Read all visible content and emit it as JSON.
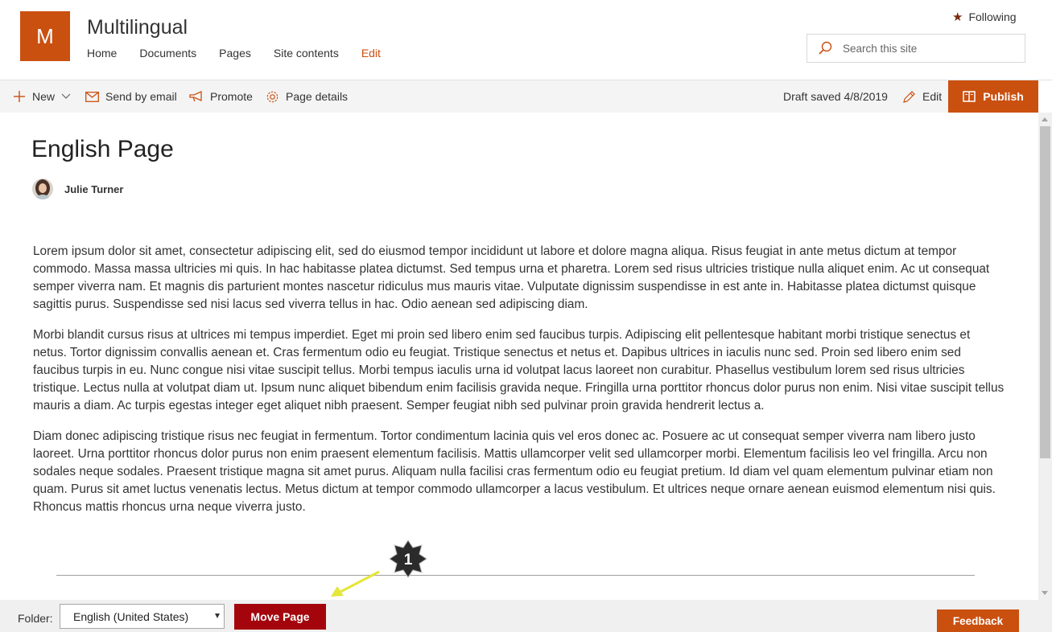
{
  "site": {
    "logo_letter": "M",
    "title": "Multilingual",
    "nav": [
      {
        "label": "Home"
      },
      {
        "label": "Documents"
      },
      {
        "label": "Pages"
      },
      {
        "label": "Site contents"
      },
      {
        "label": "Edit"
      }
    ],
    "following_label": "Following",
    "search_placeholder": "Search this site",
    "accent_color": "#ca5010"
  },
  "command_bar": {
    "new_label": "New",
    "send_email_label": "Send by email",
    "promote_label": "Promote",
    "page_details_label": "Page details",
    "draft_status": "Draft saved 4/8/2019",
    "edit_label": "Edit",
    "publish_label": "Publish"
  },
  "page": {
    "title": "English Page",
    "author": "Julie Turner",
    "paragraphs": [
      "Lorem ipsum dolor sit amet, consectetur adipiscing elit, sed do eiusmod tempor incididunt ut labore et dolore magna aliqua. Risus feugiat in ante metus dictum at tempor commodo. Massa massa ultricies mi quis. In hac habitasse platea dictumst. Sed tempus urna et pharetra. Lorem sed risus ultricies tristique nulla aliquet enim. Ac ut consequat semper viverra nam. Et magnis dis parturient montes nascetur ridiculus mus mauris vitae. Vulputate dignissim suspendisse in est ante in. Habitasse platea dictumst quisque sagittis purus. Suspendisse sed nisi lacus sed viverra tellus in hac. Odio aenean sed adipiscing diam.",
      "Morbi blandit cursus risus at ultrices mi tempus imperdiet. Eget mi proin sed libero enim sed faucibus turpis. Adipiscing elit pellentesque habitant morbi tristique senectus et netus. Tortor dignissim convallis aenean et. Cras fermentum odio eu feugiat. Tristique senectus et netus et. Dapibus ultrices in iaculis nunc sed. Proin sed libero enim sed faucibus turpis in eu. Nunc congue nisi vitae suscipit tellus. Morbi tempus iaculis urna id volutpat lacus laoreet non curabitur. Phasellus vestibulum lorem sed risus ultricies tristique. Lectus nulla at volutpat diam ut. Ipsum nunc aliquet bibendum enim facilisis gravida neque. Fringilla urna porttitor rhoncus dolor purus non enim. Nisi vitae suscipit tellus mauris a diam. Ac turpis egestas integer eget aliquet nibh praesent. Semper feugiat nibh sed pulvinar proin gravida hendrerit lectus a.",
      "Diam donec adipiscing tristique risus nec feugiat in fermentum. Tortor condimentum lacinia quis vel eros donec ac. Posuere ac ut consequat semper viverra nam libero justo laoreet. Urna porttitor rhoncus dolor purus non enim praesent elementum facilisis. Mattis ullamcorper velit sed ullamcorper morbi. Elementum facilisis leo vel fringilla. Arcu non sodales neque sodales. Praesent tristique magna sit amet purus. Aliquam nulla facilisi cras fermentum odio eu feugiat pretium. Id diam vel quam elementum pulvinar etiam non quam. Purus sit amet luctus venenatis lectus. Metus dictum at tempor commodo ullamcorper a lacus vestibulum. Et ultrices neque ornare aenean euismod elementum nisi quis. Rhoncus mattis rhoncus urna neque viverra justo."
    ]
  },
  "footer": {
    "folder_label": "Folder:",
    "folder_value": "English (United States)",
    "move_button": "Move Page",
    "feedback_button": "Feedback"
  },
  "annotation": {
    "badge_number": "1"
  }
}
